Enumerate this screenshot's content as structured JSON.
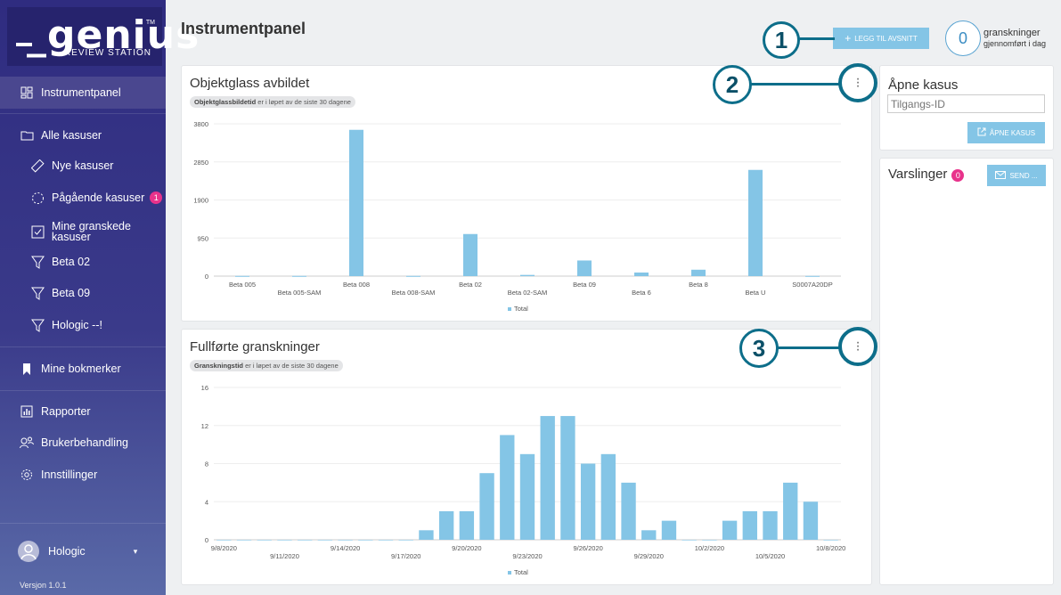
{
  "logo": {
    "word": "_genius",
    "tm": "TM",
    "sub": "REVIEW STATION"
  },
  "sidebar": {
    "items": [
      {
        "label": "Instrumentpanel",
        "icon": "dashboard-icon"
      },
      {
        "label": "Alle kasuser",
        "icon": "folder-icon"
      },
      {
        "label": "Nye kasuser",
        "icon": "slide-icon"
      },
      {
        "label": "Pågående kasuser",
        "icon": "progress-circle-icon",
        "badge": "1"
      },
      {
        "label": "Mine granskede kasuser",
        "icon": "checkbox-icon"
      },
      {
        "label": "Beta 02",
        "icon": "filter-icon"
      },
      {
        "label": "Beta 09",
        "icon": "filter-icon"
      },
      {
        "label": "Hologic --!",
        "icon": "filter-icon"
      },
      {
        "label": "Mine bokmerker",
        "icon": "bookmark-icon"
      },
      {
        "label": "Rapporter",
        "icon": "report-icon"
      },
      {
        "label": "Brukerbehandling",
        "icon": "users-icon"
      },
      {
        "label": "Innstillinger",
        "icon": "gear-icon"
      }
    ],
    "user": "Hologic",
    "version": "Versjon 1.0.1"
  },
  "header": {
    "title": "Instrumentpanel",
    "add_label": "LEGG TIL AVSNITT",
    "count": "0",
    "count_label": "granskninger",
    "count_sub": "gjennomført i dag"
  },
  "callouts": [
    "1",
    "2",
    "3"
  ],
  "card1": {
    "title": "Objektglass avbildet",
    "pill_bold": "Objektglassbildetid",
    "pill_rest": " er i løpet av de siste 30 dagene",
    "legend": "Total"
  },
  "card2": {
    "title": "Fullførte granskninger",
    "pill_bold": "Granskningstid",
    "pill_rest": " er i løpet av de siste 30 dagene",
    "legend": "Total"
  },
  "open_case": {
    "title": "Åpne kasus",
    "placeholder": "Tilgangs-ID",
    "button": "ÅPNE KASUS"
  },
  "notifications": {
    "title": "Varslinger",
    "badge": "0",
    "button": "SEND ..."
  },
  "colors": {
    "accent": "#84c5e6",
    "sidebar": "#2f2c80",
    "badge": "#e8328b",
    "callout": "#0d6e8a"
  },
  "chart_data": [
    {
      "type": "bar",
      "categories": [
        "Beta 005",
        "Beta 005-SAM",
        "Beta 008",
        "Beta 008-SAM",
        "Beta 02",
        "Beta 02-SAM",
        "Beta 09",
        "Beta 6",
        "Beta 8",
        "Beta U",
        "S0007A20DP"
      ],
      "series": [
        {
          "name": "Total",
          "values": [
            5,
            5,
            3650,
            5,
            1050,
            30,
            390,
            90,
            160,
            2650,
            5
          ]
        }
      ],
      "yticks": [
        "0",
        "950",
        "1900",
        "2850",
        "3800"
      ],
      "ylim": [
        0,
        3800
      ]
    },
    {
      "type": "bar",
      "categories": [
        "9/8/2020",
        "9/9/2020",
        "9/10/2020",
        "9/11/2020",
        "9/12/2020",
        "9/13/2020",
        "9/14/2020",
        "9/15/2020",
        "9/16/2020",
        "9/17/2020",
        "9/18/2020",
        "9/19/2020",
        "9/20/2020",
        "9/21/2020",
        "9/22/2020",
        "9/23/2020",
        "9/24/2020",
        "9/25/2020",
        "9/26/2020",
        "9/27/2020",
        "9/28/2020",
        "9/29/2020",
        "9/30/2020",
        "10/1/2020",
        "10/2/2020",
        "10/3/2020",
        "10/4/2020",
        "10/5/2020",
        "10/6/2020",
        "10/7/2020",
        "10/8/2020"
      ],
      "series": [
        {
          "name": "Total",
          "values": [
            0,
            0,
            0,
            0,
            0,
            0,
            0,
            0,
            0,
            0,
            1,
            3,
            3,
            7,
            11,
            9,
            13,
            13,
            8,
            9,
            6,
            1,
            2,
            0,
            0,
            2,
            3,
            3,
            6,
            4,
            0
          ]
        }
      ],
      "xticks": [
        "9/8/2020",
        "9/11/2020",
        "9/14/2020",
        "9/17/2020",
        "9/20/2020",
        "9/23/2020",
        "9/26/2020",
        "9/29/2020",
        "10/2/2020",
        "10/5/2020",
        "10/8/2020"
      ],
      "yticks": [
        "0",
        "4",
        "8",
        "12",
        "16"
      ],
      "ylim": [
        0,
        16
      ]
    }
  ]
}
